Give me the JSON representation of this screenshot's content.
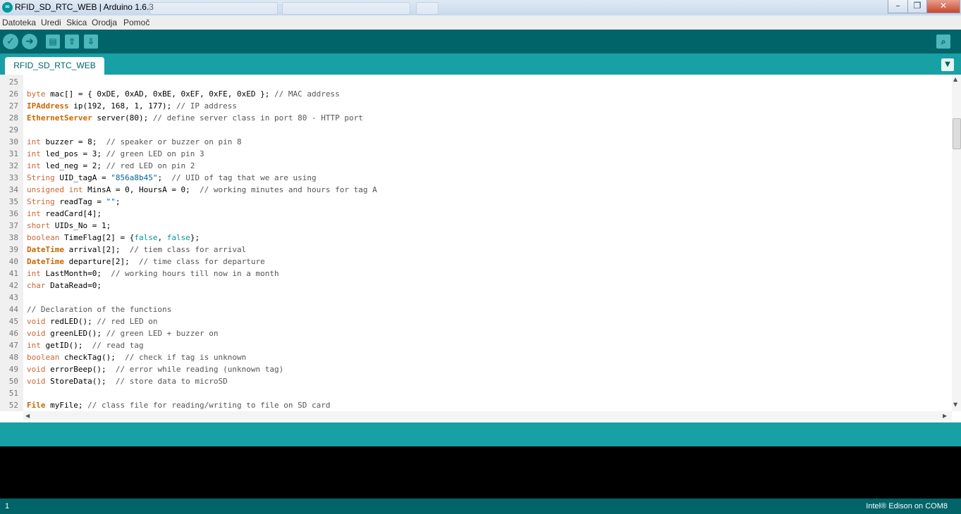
{
  "window": {
    "title": "RFID_SD_RTC_WEB | Arduino 1.6.3",
    "minimize": "–",
    "maximize": "❐",
    "close": "✕"
  },
  "menu": [
    "Datoteka",
    "Uredi",
    "Skica",
    "Orodja",
    "Pomoč"
  ],
  "toolbar": {
    "verify": "✓",
    "upload": "➜",
    "new": "▤",
    "open": "⇧",
    "save": "⇩",
    "serial_monitor": "⌕"
  },
  "tab": {
    "label": "RFID_SD_RTC_WEB",
    "menu_icon": "▼"
  },
  "colors": {
    "teal_dark": "#006468",
    "teal": "#17a1a5",
    "keyword": "#cc6600",
    "literal": "#00979c",
    "string": "#006699"
  },
  "code_lines": [
    {
      "n": "25",
      "tokens": []
    },
    {
      "n": "26",
      "tokens": [
        [
          "kw-type",
          "byte"
        ],
        [
          "plain",
          " mac[] = { 0xDE, 0xAD, 0xBE, 0xEF, 0xFE, 0xED }; "
        ],
        [
          "com",
          "// MAC address"
        ]
      ]
    },
    {
      "n": "27",
      "tokens": [
        [
          "kw-class",
          "IPAddress"
        ],
        [
          "plain",
          " ip(192, 168, 1, 177); "
        ],
        [
          "com",
          "// IP address"
        ]
      ]
    },
    {
      "n": "28",
      "tokens": [
        [
          "kw-class",
          "EthernetServer"
        ],
        [
          "plain",
          " server(80); "
        ],
        [
          "com",
          "// define server class in port 80 - HTTP port"
        ]
      ]
    },
    {
      "n": "29",
      "tokens": []
    },
    {
      "n": "30",
      "tokens": [
        [
          "kw-type",
          "int"
        ],
        [
          "plain",
          " buzzer = 8;  "
        ],
        [
          "com",
          "// speaker or buzzer on pin 8"
        ]
      ]
    },
    {
      "n": "31",
      "tokens": [
        [
          "kw-type",
          "int"
        ],
        [
          "plain",
          " led_pos = 3; "
        ],
        [
          "com",
          "// green LED on pin 3"
        ]
      ]
    },
    {
      "n": "32",
      "tokens": [
        [
          "kw-type",
          "int"
        ],
        [
          "plain",
          " led_neg = 2; "
        ],
        [
          "com",
          "// red LED on pin 2"
        ]
      ]
    },
    {
      "n": "33",
      "tokens": [
        [
          "kw-type",
          "String"
        ],
        [
          "plain",
          " UID_tagA = "
        ],
        [
          "str",
          "\"856a8b45\""
        ],
        [
          "plain",
          ";  "
        ],
        [
          "com",
          "// UID of tag that we are using"
        ]
      ]
    },
    {
      "n": "34",
      "tokens": [
        [
          "kw-type",
          "unsigned int"
        ],
        [
          "plain",
          " MinsA = 0, HoursA = 0;  "
        ],
        [
          "com",
          "// working minutes and hours for tag A"
        ]
      ]
    },
    {
      "n": "35",
      "tokens": [
        [
          "kw-type",
          "String"
        ],
        [
          "plain",
          " readTag = "
        ],
        [
          "str",
          "\"\""
        ],
        [
          "plain",
          ";"
        ]
      ]
    },
    {
      "n": "36",
      "tokens": [
        [
          "kw-type",
          "int"
        ],
        [
          "plain",
          " readCard[4];"
        ]
      ]
    },
    {
      "n": "37",
      "tokens": [
        [
          "kw-type",
          "short"
        ],
        [
          "plain",
          " UIDs_No = 1;"
        ]
      ]
    },
    {
      "n": "38",
      "tokens": [
        [
          "kw-type",
          "boolean"
        ],
        [
          "plain",
          " TimeFlag[2] = {"
        ],
        [
          "kw-lit",
          "false"
        ],
        [
          "plain",
          ", "
        ],
        [
          "kw-lit",
          "false"
        ],
        [
          "plain",
          "};"
        ]
      ]
    },
    {
      "n": "39",
      "tokens": [
        [
          "kw-class",
          "DateTime"
        ],
        [
          "plain",
          " arrival[2];  "
        ],
        [
          "com",
          "// tiem class for arrival"
        ]
      ]
    },
    {
      "n": "40",
      "tokens": [
        [
          "kw-class",
          "DateTime"
        ],
        [
          "plain",
          " departure[2];  "
        ],
        [
          "com",
          "// time class for departure"
        ]
      ]
    },
    {
      "n": "41",
      "tokens": [
        [
          "kw-type",
          "int"
        ],
        [
          "plain",
          " LastMonth=0;  "
        ],
        [
          "com",
          "// working hours till now in a month"
        ]
      ]
    },
    {
      "n": "42",
      "tokens": [
        [
          "kw-type",
          "char"
        ],
        [
          "plain",
          " DataRead=0;"
        ]
      ]
    },
    {
      "n": "43",
      "tokens": []
    },
    {
      "n": "44",
      "tokens": [
        [
          "com",
          "// Declaration of the functions"
        ]
      ]
    },
    {
      "n": "45",
      "tokens": [
        [
          "kw-type",
          "void"
        ],
        [
          "plain",
          " redLED(); "
        ],
        [
          "com",
          "// red LED on"
        ]
      ]
    },
    {
      "n": "46",
      "tokens": [
        [
          "kw-type",
          "void"
        ],
        [
          "plain",
          " greenLED(); "
        ],
        [
          "com",
          "// green LED + buzzer on"
        ]
      ]
    },
    {
      "n": "47",
      "tokens": [
        [
          "kw-type",
          "int"
        ],
        [
          "plain",
          " getID();  "
        ],
        [
          "com",
          "// read tag"
        ]
      ]
    },
    {
      "n": "48",
      "tokens": [
        [
          "kw-type",
          "boolean"
        ],
        [
          "plain",
          " checkTag();  "
        ],
        [
          "com",
          "// check if tag is unknown"
        ]
      ]
    },
    {
      "n": "49",
      "tokens": [
        [
          "kw-type",
          "void"
        ],
        [
          "plain",
          " errorBeep();  "
        ],
        [
          "com",
          "// error while reading (unknown tag)"
        ]
      ]
    },
    {
      "n": "50",
      "tokens": [
        [
          "kw-type",
          "void"
        ],
        [
          "plain",
          " StoreData();  "
        ],
        [
          "com",
          "// store data to microSD"
        ]
      ]
    },
    {
      "n": "51",
      "tokens": []
    },
    {
      "n": "52",
      "tokens": [
        [
          "kw-class",
          "File"
        ],
        [
          "plain",
          " myFile; "
        ],
        [
          "com",
          "// class file for reading/writing to file on SD card"
        ]
      ]
    }
  ],
  "status": {
    "line": "1",
    "board": "Intel® Edison on COM8"
  }
}
